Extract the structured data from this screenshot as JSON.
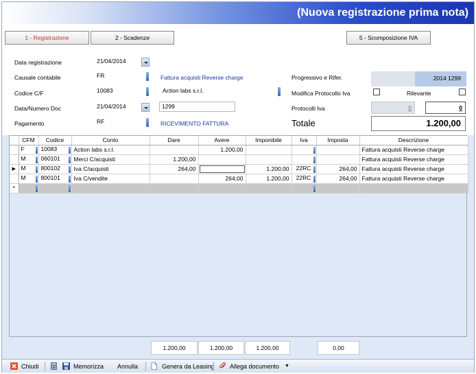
{
  "window": {
    "title": "(Nuova registrazione prima nota)"
  },
  "tabs": [
    {
      "label": "1 - Registrazione",
      "active": true
    },
    {
      "label": "2 - Scadenze"
    },
    {
      "label": "5 - Scomposizione IVA"
    }
  ],
  "form": {
    "data_registrazione": {
      "label": "Data registrazione",
      "value": "21/04/2014"
    },
    "causale": {
      "label": "Causale contabile",
      "value": "FR",
      "desc": "Fattura acquisti Reverse charge"
    },
    "codice_cf": {
      "label": "Codice C/F",
      "value": "10083",
      "desc": "Action labs s.r.l."
    },
    "data_numero_doc": {
      "label": "Data/Numero Doc",
      "date": "21/04/2014",
      "number": "1299"
    },
    "pagamento": {
      "label": "Pagamento",
      "value": "RF",
      "desc": "RICEVIMENTO FATTURA"
    },
    "progressivo": {
      "label": "Progressivo e Rifer.",
      "value": "2014 1299"
    },
    "modifica_protocollo": {
      "label": "Modifica Protocollo Iva",
      "checked": false
    },
    "rilevante": {
      "label": "Rilevante",
      "checked": false
    },
    "protocolli": {
      "label": "Protocolli Iva",
      "value1": "0",
      "value2": "0"
    },
    "totale": {
      "label": "Totale",
      "value": "1.200,00"
    }
  },
  "grid": {
    "columns": [
      "CFM",
      "Codice",
      "Conto",
      "Dare",
      "Avere",
      "Imponibile",
      "Iva",
      "Imposta",
      "Descrizione"
    ],
    "rows": [
      {
        "cfm": "F",
        "codice": "10083",
        "conto": "Action labs s.r.l.",
        "dare": "",
        "avere": "1.200,00",
        "imponibile": "",
        "iva": "",
        "imposta": "",
        "descrizione": "Fattura acquisti Reverse charge"
      },
      {
        "cfm": "M",
        "codice": "060101",
        "conto": "Merci C/acquisti",
        "dare": "1.200,00",
        "avere": "",
        "imponibile": "",
        "iva": "",
        "imposta": "",
        "descrizione": "Fattura acquisti Reverse charge"
      },
      {
        "cfm": "M",
        "codice": "800102",
        "conto": "Iva C/acquisti",
        "dare": "264,00",
        "avere": "",
        "imponibile": "1.200,00",
        "iva": "22RC",
        "imposta": "264,00",
        "descrizione": "Fattura acquisti Reverse charge"
      },
      {
        "cfm": "M",
        "codice": "800101",
        "conto": "Iva C/vendite",
        "dare": "",
        "avere": "264,00",
        "imponibile": "1.200,00",
        "iva": "22RC",
        "imposta": "264,00",
        "descrizione": "Fattura acquisti Reverse charge"
      }
    ],
    "new_row_marker": "*",
    "current_row_marker": "▶"
  },
  "totals": {
    "dare": "1.200,00",
    "avere": "1.200,00",
    "imponibile": "1.200,00",
    "imposta": "0,00"
  },
  "toolbar": {
    "chiudi": "Chiudi",
    "memorizza": "Memorizza",
    "annulla": "Annulla",
    "genera_leasing": "Genera da Leasing",
    "allega": "Allega documento"
  },
  "icons": [
    "close-icon",
    "calculator-icon",
    "save-icon",
    "document-icon",
    "attachment-icon",
    "dropdown-arrow-icon"
  ]
}
